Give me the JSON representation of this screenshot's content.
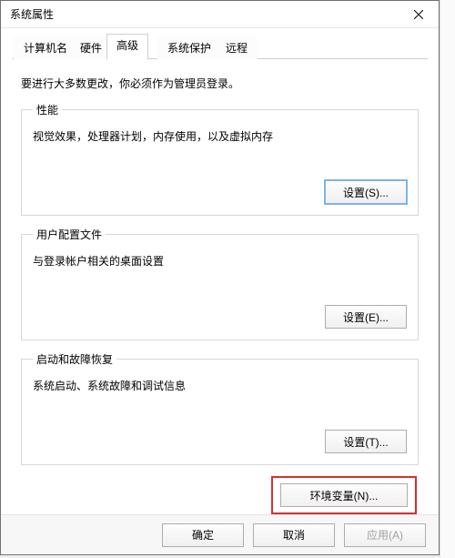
{
  "window": {
    "title": "系统属性"
  },
  "tabs": {
    "t0": "计算机名",
    "t1": "硬件",
    "t2": "高级",
    "t3": "系统保护",
    "t4": "远程"
  },
  "page": {
    "intro": "要进行大多数更改，你必须作为管理员登录。"
  },
  "groups": {
    "performance": {
      "legend": "性能",
      "desc": "视觉效果，处理器计划，内存使用，以及虚拟内存",
      "button": "设置(S)..."
    },
    "userprofile": {
      "legend": "用户配置文件",
      "desc": "与登录帐户相关的桌面设置",
      "button": "设置(E)..."
    },
    "startup": {
      "legend": "启动和故障恢复",
      "desc": "系统启动、系统故障和调试信息",
      "button": "设置(T)..."
    }
  },
  "env": {
    "button": "环境变量(N)..."
  },
  "footer": {
    "ok": "确定",
    "cancel": "取消",
    "apply": "应用(A)"
  }
}
